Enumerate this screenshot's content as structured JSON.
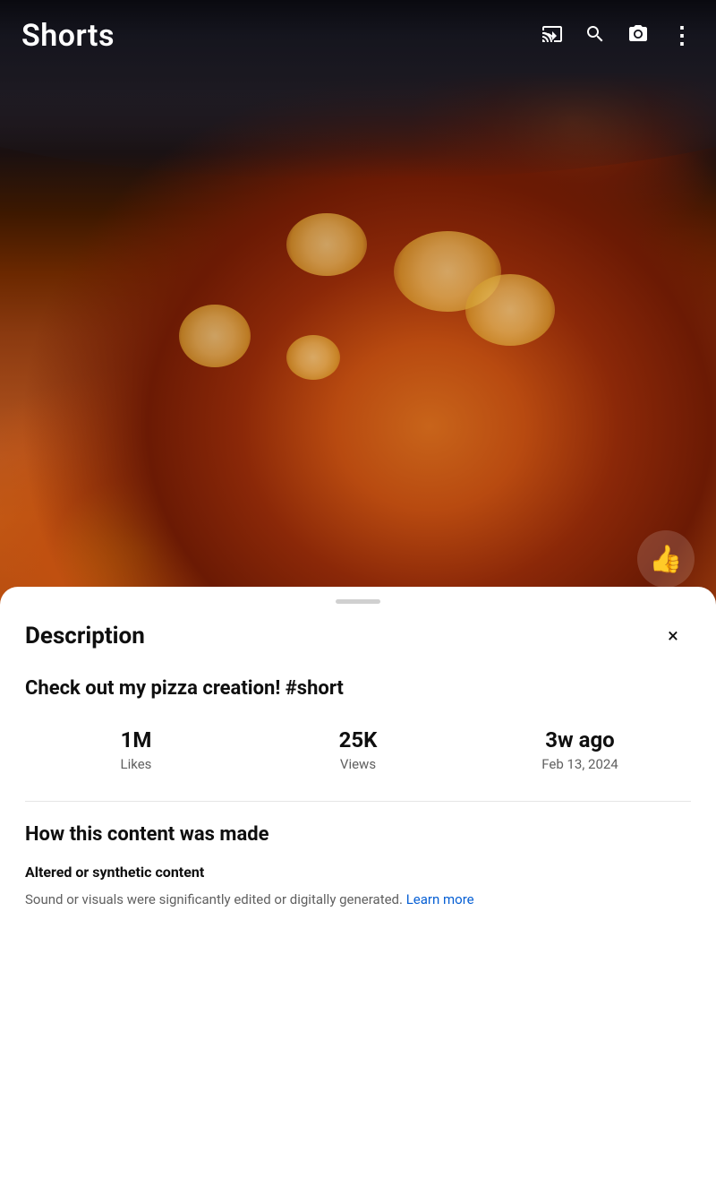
{
  "header": {
    "title": "Shorts",
    "icons": {
      "cast": "cast-icon",
      "search": "search-icon",
      "camera": "camera-icon",
      "more": "more-icon"
    }
  },
  "video": {
    "thumbs_up_label": "👍"
  },
  "description_sheet": {
    "drag_handle": "",
    "title": "Description",
    "close_label": "×",
    "video_title": "Check out my pizza creation! #short",
    "stats": {
      "likes_value": "1M",
      "likes_label": "Likes",
      "views_value": "25K",
      "views_label": "Views",
      "time_value": "3w ago",
      "date_label": "Feb 13, 2024"
    },
    "content_section": {
      "title": "How this content was made",
      "type_label": "Altered or synthetic content",
      "description_part1": "Sound or visuals were significantly edited or digitally generated. ",
      "learn_more_label": "Learn more"
    }
  }
}
